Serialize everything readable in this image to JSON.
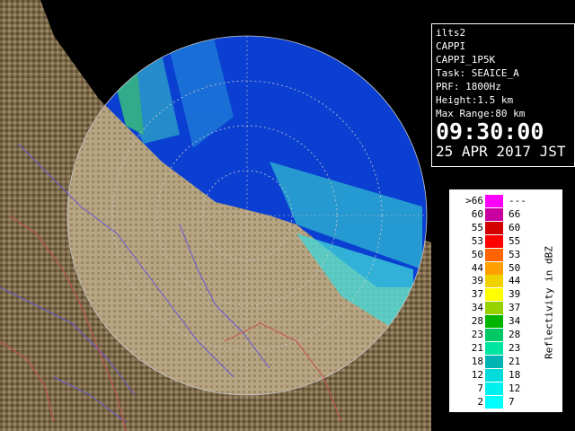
{
  "info": {
    "station": "ilts2",
    "product": "CAPPI",
    "product_code": "CAPPI_1P5K",
    "task": "Task: SEAICE_A",
    "prf": "PRF: 1800Hz",
    "height": "Height:1.5 km",
    "max_range": "Max Range:80 km",
    "time": "09:30:00",
    "date": "25 APR 2017 JST"
  },
  "legend": {
    "title": "Reflectivity in dBZ",
    "rows": [
      {
        "lo": ">66",
        "hi": "---",
        "color": "#ff00ff"
      },
      {
        "lo": "60",
        "hi": "66",
        "color": "#c800a0"
      },
      {
        "lo": "55",
        "hi": "60",
        "color": "#d20000"
      },
      {
        "lo": "53",
        "hi": "55",
        "color": "#ff0000"
      },
      {
        "lo": "50",
        "hi": "53",
        "color": "#ff6400"
      },
      {
        "lo": "44",
        "hi": "50",
        "color": "#ffa000"
      },
      {
        "lo": "39",
        "hi": "44",
        "color": "#f0d200"
      },
      {
        "lo": "37",
        "hi": "39",
        "color": "#ffff00"
      },
      {
        "lo": "34",
        "hi": "37",
        "color": "#96d200"
      },
      {
        "lo": "28",
        "hi": "34",
        "color": "#00b400"
      },
      {
        "lo": "23",
        "hi": "28",
        "color": "#00c864"
      },
      {
        "lo": "21",
        "hi": "23",
        "color": "#00e6a0"
      },
      {
        "lo": "18",
        "hi": "21",
        "color": "#00b4b4"
      },
      {
        "lo": "12",
        "hi": "18",
        "color": "#00dcdc"
      },
      {
        "lo": "7",
        "hi": "12",
        "color": "#00f0f0"
      },
      {
        "lo": "2",
        "hi": "7",
        "color": "#00ffff"
      }
    ]
  },
  "map": {
    "sea_color": "#0a3fd2",
    "land_color": "#7d6a4a",
    "echo_color": "#3fe6e6",
    "range_ring_color": "#c8c8c8",
    "river_color": "#6a5ad2",
    "border_color": "#c85050"
  }
}
